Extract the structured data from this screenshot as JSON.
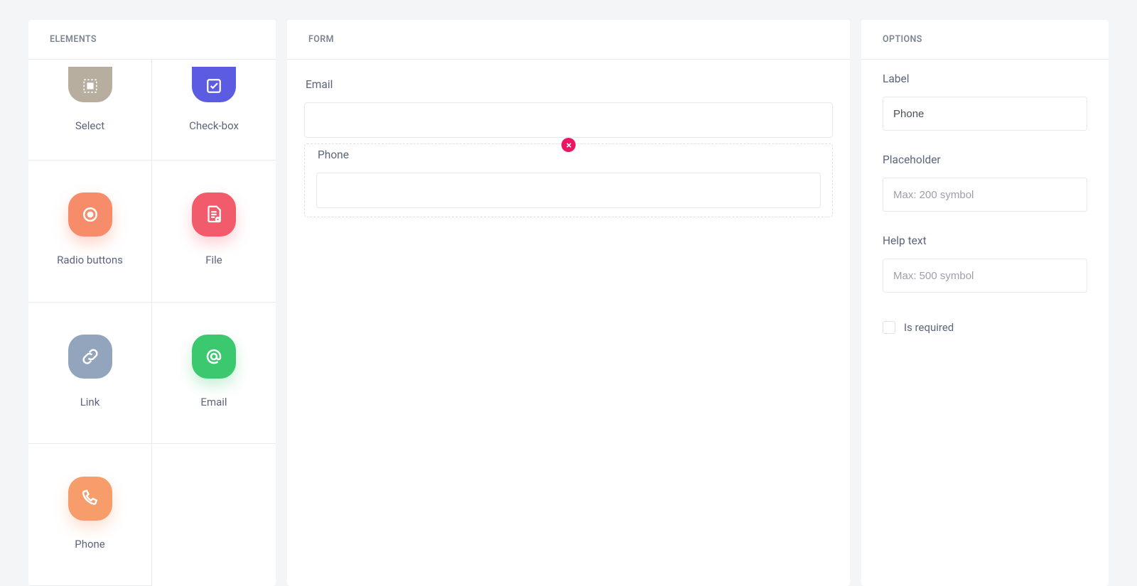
{
  "panels": {
    "elements_title": "ELEMENTS",
    "form_title": "FORM",
    "options_title": "OPTIONS"
  },
  "elements": [
    {
      "id": "select",
      "label": "Select",
      "icon": "select-icon"
    },
    {
      "id": "checkbox",
      "label": "Check-box",
      "icon": "checkbox-icon"
    },
    {
      "id": "radio",
      "label": "Radio buttons",
      "icon": "radio-icon"
    },
    {
      "id": "file",
      "label": "File",
      "icon": "file-icon"
    },
    {
      "id": "link",
      "label": "Link",
      "icon": "link-icon"
    },
    {
      "id": "email",
      "label": "Email",
      "icon": "email-icon"
    },
    {
      "id": "phone",
      "label": "Phone",
      "icon": "phone-icon"
    }
  ],
  "form": {
    "fields": [
      {
        "id": "email",
        "label": "Email",
        "value": "",
        "selected": false
      },
      {
        "id": "phone",
        "label": "Phone",
        "value": "",
        "selected": true
      }
    ]
  },
  "options": {
    "label_field_label": "Label",
    "label_value": "Phone",
    "placeholder_field_label": "Placeholder",
    "placeholder_placeholder": "Max: 200 symbol",
    "placeholder_value": "",
    "helptext_field_label": "Help text",
    "helptext_placeholder": "Max: 500 symbol",
    "helptext_value": "",
    "required_label": "Is required",
    "required_checked": false
  },
  "colors": {
    "brand_purple": "#5b5ce2",
    "danger": "#ec1561",
    "bg": "#f4f5f7"
  }
}
